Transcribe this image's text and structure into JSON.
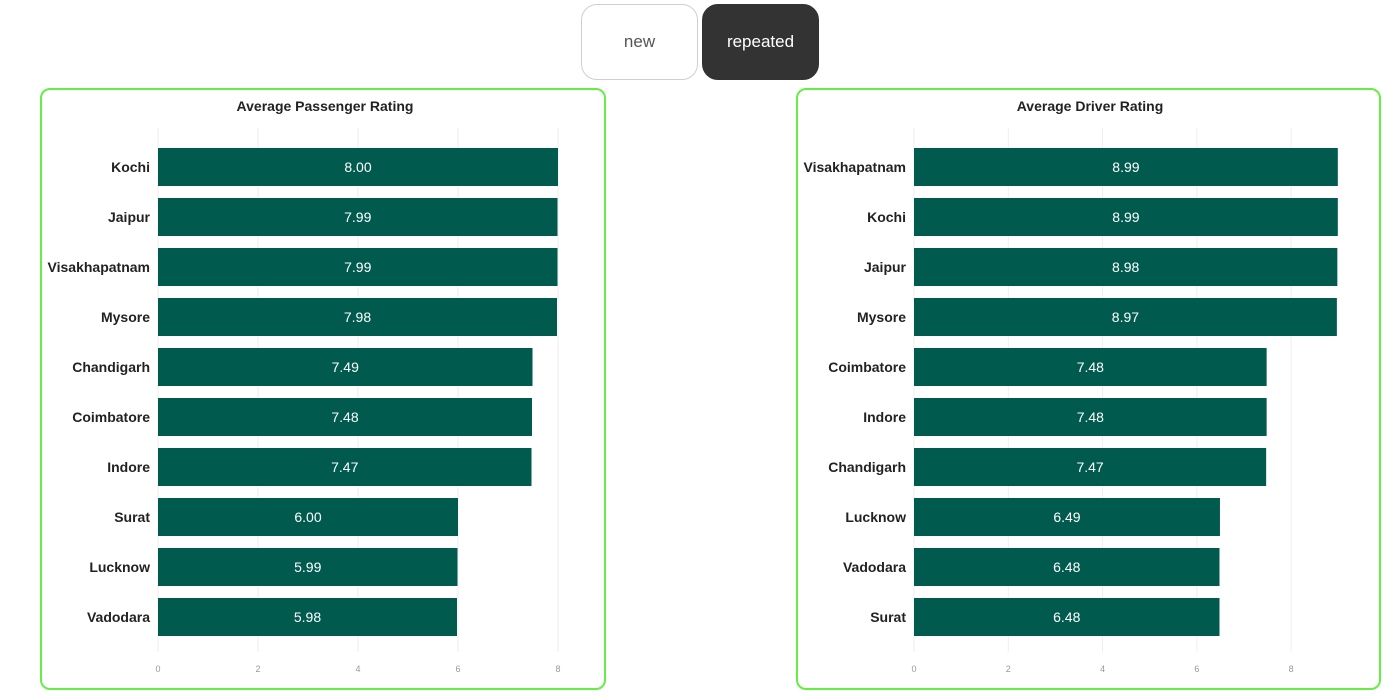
{
  "toggle": {
    "new_label": "new",
    "repeated_label": "repeated",
    "active": "repeated"
  },
  "colors": {
    "bar": "#005a4e",
    "panel_border": "#66ee44",
    "active_toggle": "#333333"
  },
  "chart_data": [
    {
      "type": "bar",
      "orientation": "horizontal",
      "title": "Average Passenger Rating",
      "categories": [
        "Kochi",
        "Jaipur",
        "Visakhapatnam",
        "Mysore",
        "Chandigarh",
        "Coimbatore",
        "Indore",
        "Surat",
        "Lucknow",
        "Vadodara"
      ],
      "values": [
        8.0,
        7.99,
        7.99,
        7.98,
        7.49,
        7.48,
        7.47,
        6.0,
        5.99,
        5.98
      ],
      "value_labels": [
        "8.00",
        "7.99",
        "7.99",
        "7.98",
        "7.49",
        "7.48",
        "7.47",
        "6.00",
        "5.99",
        "5.98"
      ],
      "xticks": [
        0,
        2,
        4,
        6,
        8
      ],
      "xlim": [
        0,
        8.4
      ],
      "grid": true
    },
    {
      "type": "bar",
      "orientation": "horizontal",
      "title": "Average Driver Rating",
      "categories": [
        "Visakhapatnam",
        "Kochi",
        "Jaipur",
        "Mysore",
        "Coimbatore",
        "Indore",
        "Chandigarh",
        "Lucknow",
        "Vadodara",
        "Surat"
      ],
      "values": [
        8.99,
        8.99,
        8.98,
        8.97,
        7.48,
        7.48,
        7.47,
        6.49,
        6.48,
        6.48
      ],
      "value_labels": [
        "8.99",
        "8.99",
        "8.98",
        "8.97",
        "7.48",
        "7.48",
        "7.47",
        "6.49",
        "6.48",
        "6.48"
      ],
      "xticks": [
        0,
        2,
        4,
        6,
        8
      ],
      "xlim": [
        0,
        8.4
      ],
      "grid": true
    }
  ]
}
